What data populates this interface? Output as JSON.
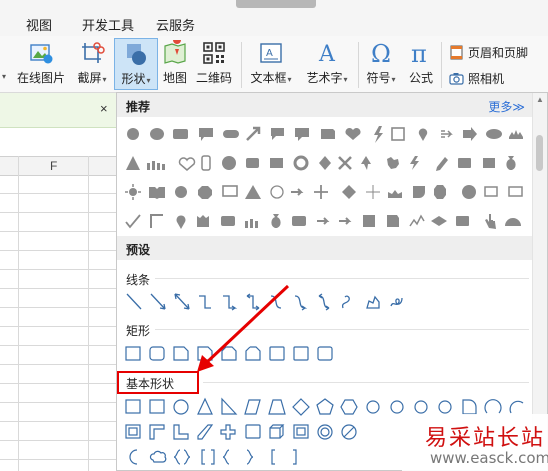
{
  "tabs": {
    "view": "视图",
    "developer": "开发工具",
    "cloud": "云服务"
  },
  "ribbon": {
    "online_picture": "在线图片",
    "screenshot": "截屏",
    "shape": "形状",
    "map": "地图",
    "qrcode": "二维码",
    "textbox": "文本框",
    "wordart": "艺术字",
    "symbol": "符号",
    "formula": "公式",
    "header_footer": "页眉和页脚",
    "camera": "照相机",
    "caret": "▾"
  },
  "taskbar": {
    "close": "×"
  },
  "sheet": {
    "column": "F"
  },
  "panel": {
    "recommended": "推荐",
    "more": "更多≫",
    "presets": "预设",
    "lines": "线条",
    "rectangles": "矩形",
    "basic_shapes": "基本形状"
  },
  "watermark": {
    "title": "易采站长站",
    "url": "www.easck.com"
  },
  "colors": {
    "accent_blue": "#2d6fd6",
    "annotation_red": "#e60000",
    "shape_gray": "#8a8a8a",
    "shape_outline": "#3a6ea8"
  }
}
